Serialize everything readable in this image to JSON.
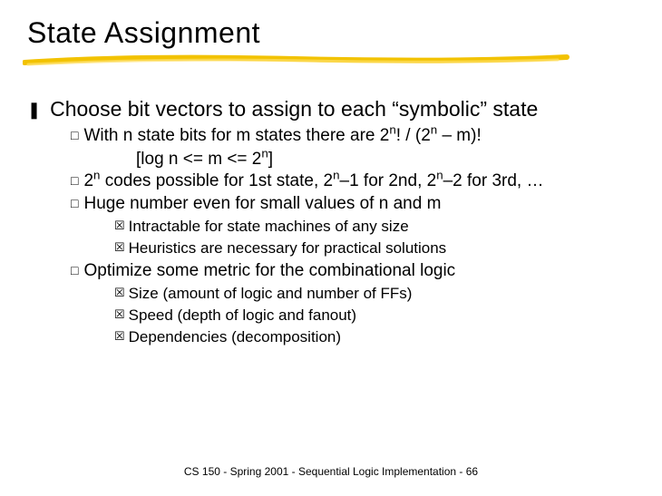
{
  "title": "State Assignment",
  "main": {
    "bullet_glyph": "❚",
    "text": "Choose bit vectors to assign to each “symbolic” state"
  },
  "sub_bullet_glyph": "□",
  "sub_sub_bullet_glyph": "☒",
  "sub_items": {
    "s0_pre": "With n state bits for m states there are 2",
    "s0_sup1": "n",
    "s0_mid1": "! / (2",
    "s0_sup2": "n",
    "s0_post": " – m)!",
    "s0b_pre": "[log n <=  m <=  2",
    "s0b_sup": "n",
    "s0b_post": "]",
    "s1_pre": "2",
    "s1_sup1": "n",
    "s1_mid1": " codes possible for 1st state, 2",
    "s1_sup2": "n",
    "s1_mid2": "–1 for 2nd, 2",
    "s1_sup3": "n",
    "s1_post": "–2 for 3rd, …",
    "s2": "Huge number even for small values of n and m",
    "s3": "Optimize some metric for the combinational logic"
  },
  "subsub_a": {
    "a0": "Intractable for state machines of any size",
    "a1": "Heuristics are necessary for practical solutions"
  },
  "subsub_b": {
    "b0": "Size (amount of logic and number of FFs)",
    "b1": "Speed (depth of logic and fanout)",
    "b2": "Dependencies (decomposition)"
  },
  "footer": "CS 150 - Spring  2001 - Sequential Logic Implementation - 66"
}
